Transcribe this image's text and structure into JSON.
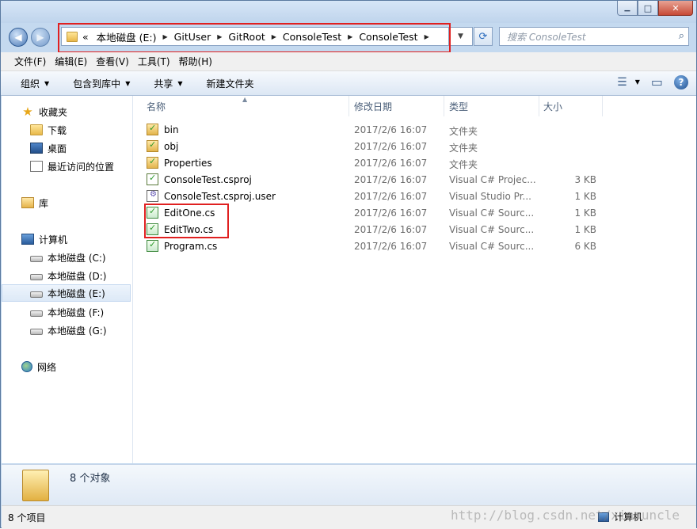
{
  "window": {
    "controls": {
      "minimize": "▁",
      "maximize": "□",
      "close": "✕"
    }
  },
  "nav": {
    "back_glyph": "◀",
    "forward_glyph": "▶",
    "address": {
      "overflow": "«",
      "crumbs": [
        "本地磁盘 (E:)",
        "GitUser",
        "GitRoot",
        "ConsoleTest",
        "ConsoleTest"
      ]
    },
    "dropdown_glyph": "▼",
    "refresh_glyph": "⟳",
    "search_placeholder": "搜索 ConsoleTest",
    "search_icon": "⌕"
  },
  "menu": [
    "文件(F)",
    "编辑(E)",
    "查看(V)",
    "工具(T)",
    "帮助(H)"
  ],
  "toolbar": {
    "organize": "组织",
    "include_library": "包含到库中",
    "share": "共享",
    "new_folder": "新建文件夹",
    "dd_glyph": "▼",
    "view_glyph": "☰",
    "preview_glyph": "▭",
    "help_glyph": "?"
  },
  "sidebar": {
    "favorites": {
      "label": "收藏夹",
      "icon": "star-icon"
    },
    "favorite_items": [
      {
        "label": "下载",
        "icon": "download-folder-icon"
      },
      {
        "label": "桌面",
        "icon": "desktop-icon"
      },
      {
        "label": "最近访问的位置",
        "icon": "recent-places-icon"
      }
    ],
    "libraries": {
      "label": "库",
      "icon": "library-icon"
    },
    "computer": {
      "label": "计算机",
      "icon": "computer-icon"
    },
    "drives": [
      {
        "label": "本地磁盘 (C:)",
        "selected": false
      },
      {
        "label": "本地磁盘 (D:)",
        "selected": false
      },
      {
        "label": "本地磁盘 (E:)",
        "selected": true
      },
      {
        "label": "本地磁盘 (F:)",
        "selected": false
      },
      {
        "label": "本地磁盘 (G:)",
        "selected": false
      }
    ],
    "network": {
      "label": "网络",
      "icon": "network-icon"
    }
  },
  "columns": {
    "name": "名称",
    "date": "修改日期",
    "type": "类型",
    "size": "大小",
    "sort_glyph": "▲"
  },
  "files": [
    {
      "name": "bin",
      "date": "2017/2/6 16:07",
      "type": "文件夹",
      "size": "",
      "kind": "dir"
    },
    {
      "name": "obj",
      "date": "2017/2/6 16:07",
      "type": "文件夹",
      "size": "",
      "kind": "dir"
    },
    {
      "name": "Properties",
      "date": "2017/2/6 16:07",
      "type": "文件夹",
      "size": "",
      "kind": "dir"
    },
    {
      "name": "ConsoleTest.csproj",
      "date": "2017/2/6 16:07",
      "type": "Visual C# Projec...",
      "size": "3 KB",
      "kind": "proj"
    },
    {
      "name": "ConsoleTest.csproj.user",
      "date": "2017/2/6 16:07",
      "type": "Visual Studio Pr...",
      "size": "1 KB",
      "kind": "user"
    },
    {
      "name": "EditOne.cs",
      "date": "2017/2/6 16:07",
      "type": "Visual C# Sourc...",
      "size": "1 KB",
      "kind": "cs"
    },
    {
      "name": "EditTwo.cs",
      "date": "2017/2/6 16:07",
      "type": "Visual C# Sourc...",
      "size": "1 KB",
      "kind": "cs"
    },
    {
      "name": "Program.cs",
      "date": "2017/2/6 16:07",
      "type": "Visual C# Sourc...",
      "size": "6 KB",
      "kind": "cs"
    }
  ],
  "details": {
    "count_text": "8 个对象"
  },
  "status": {
    "items_text": "8 个项目",
    "location": "计算机"
  },
  "watermark": "http://blog.csdn.net/xiaouncle",
  "colors": {
    "highlight_box": "#e02020",
    "accent": "#2a6bbd"
  }
}
